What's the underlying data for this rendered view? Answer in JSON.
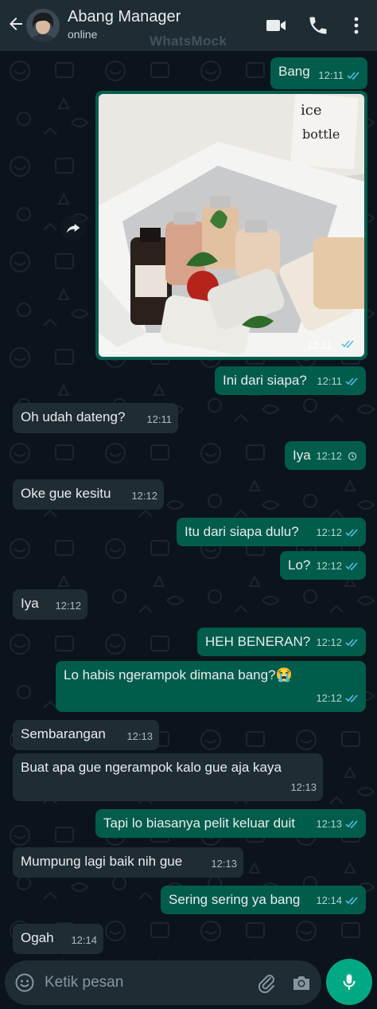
{
  "header": {
    "contact_name": "Abang Manager",
    "status": "online",
    "watermark": "WhatsMock"
  },
  "photo": {
    "sign_line1": "ice",
    "sign_line2": "bottle",
    "time": "12:11"
  },
  "messages": [
    {
      "text": "Bang",
      "time": "12:11",
      "dir": "out",
      "status": "read"
    },
    {
      "text": "Ini dari siapa?",
      "time": "12:11",
      "dir": "out",
      "status": "read"
    },
    {
      "text": "Oh udah dateng?",
      "time": "12:11",
      "dir": "in"
    },
    {
      "text": "Iya",
      "time": "12:12",
      "dir": "out",
      "status": "pending"
    },
    {
      "text": "Oke gue kesitu",
      "time": "12:12",
      "dir": "in"
    },
    {
      "text": "Itu dari siapa dulu?",
      "time": "12:12",
      "dir": "out",
      "status": "read"
    },
    {
      "text": "Lo?",
      "time": "12:12",
      "dir": "out",
      "status": "read"
    },
    {
      "text": "Iya",
      "time": "12:12",
      "dir": "in"
    },
    {
      "text": "HEH BENERAN?",
      "time": "12:12",
      "dir": "out",
      "status": "read"
    },
    {
      "text": "Lo habis ngerampok dimana bang?😭",
      "time": "12:12",
      "dir": "out",
      "status": "read"
    },
    {
      "text": "Sembarangan",
      "time": "12:13",
      "dir": "in"
    },
    {
      "text": "Buat apa gue ngerampok kalo gue aja kaya",
      "time": "12:13",
      "dir": "in"
    },
    {
      "text": "Tapi lo biasanya pelit keluar duit",
      "time": "12:13",
      "dir": "out",
      "status": "read"
    },
    {
      "text": "Mumpung lagi baik nih gue",
      "time": "12:13",
      "dir": "in"
    },
    {
      "text": "Sering sering ya bang",
      "time": "12:14",
      "dir": "out",
      "status": "read"
    },
    {
      "text": "Ogah",
      "time": "12:14",
      "dir": "in"
    }
  ],
  "input": {
    "placeholder": "Ketik pesan"
  },
  "icons": {
    "back": "arrow-left-icon",
    "video": "video-call-icon",
    "call": "phone-icon",
    "menu": "more-vert-icon",
    "emoji": "emoji-icon",
    "attach": "paperclip-icon",
    "camera": "camera-icon",
    "mic": "mic-icon",
    "forward": "forward-icon"
  },
  "colors": {
    "header": "#1f2c34",
    "background": "#0b141a",
    "outgoing": "#005c4b",
    "incoming": "#1f2c34",
    "read_ticks": "#53bdeb",
    "accent": "#00a884"
  }
}
